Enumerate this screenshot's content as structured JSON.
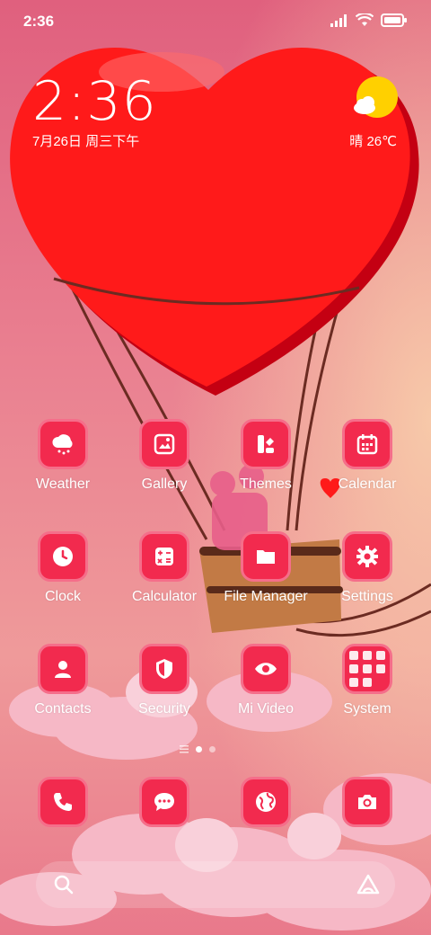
{
  "status": {
    "time": "2:36"
  },
  "lockclock": {
    "time": "2:36",
    "date": "7月26日 周三下午"
  },
  "weather": {
    "text": "晴 26℃",
    "icon": "sunny-cloud-icon"
  },
  "apps": [
    {
      "label": "Weather",
      "icon": "weather-icon"
    },
    {
      "label": "Gallery",
      "icon": "gallery-icon"
    },
    {
      "label": "Themes",
      "icon": "themes-icon"
    },
    {
      "label": "Calendar",
      "icon": "calendar-icon"
    },
    {
      "label": "Clock",
      "icon": "clock-icon"
    },
    {
      "label": "Calculator",
      "icon": "calculator-icon"
    },
    {
      "label": "File Manager",
      "icon": "folder-icon"
    },
    {
      "label": "Settings",
      "icon": "gear-icon"
    },
    {
      "label": "Contacts",
      "icon": "person-icon"
    },
    {
      "label": "Security",
      "icon": "shield-icon"
    },
    {
      "label": "Mi Video",
      "icon": "eye-icon"
    },
    {
      "label": "System",
      "icon": "folder-grid-icon"
    }
  ],
  "dock": [
    {
      "icon": "phone-icon"
    },
    {
      "icon": "message-icon"
    },
    {
      "icon": "browser-icon"
    },
    {
      "icon": "camera-icon"
    }
  ],
  "colors": {
    "tile": "#f22a4e",
    "tile_border": "#f56e8a",
    "heart": "#ff1a1a"
  }
}
